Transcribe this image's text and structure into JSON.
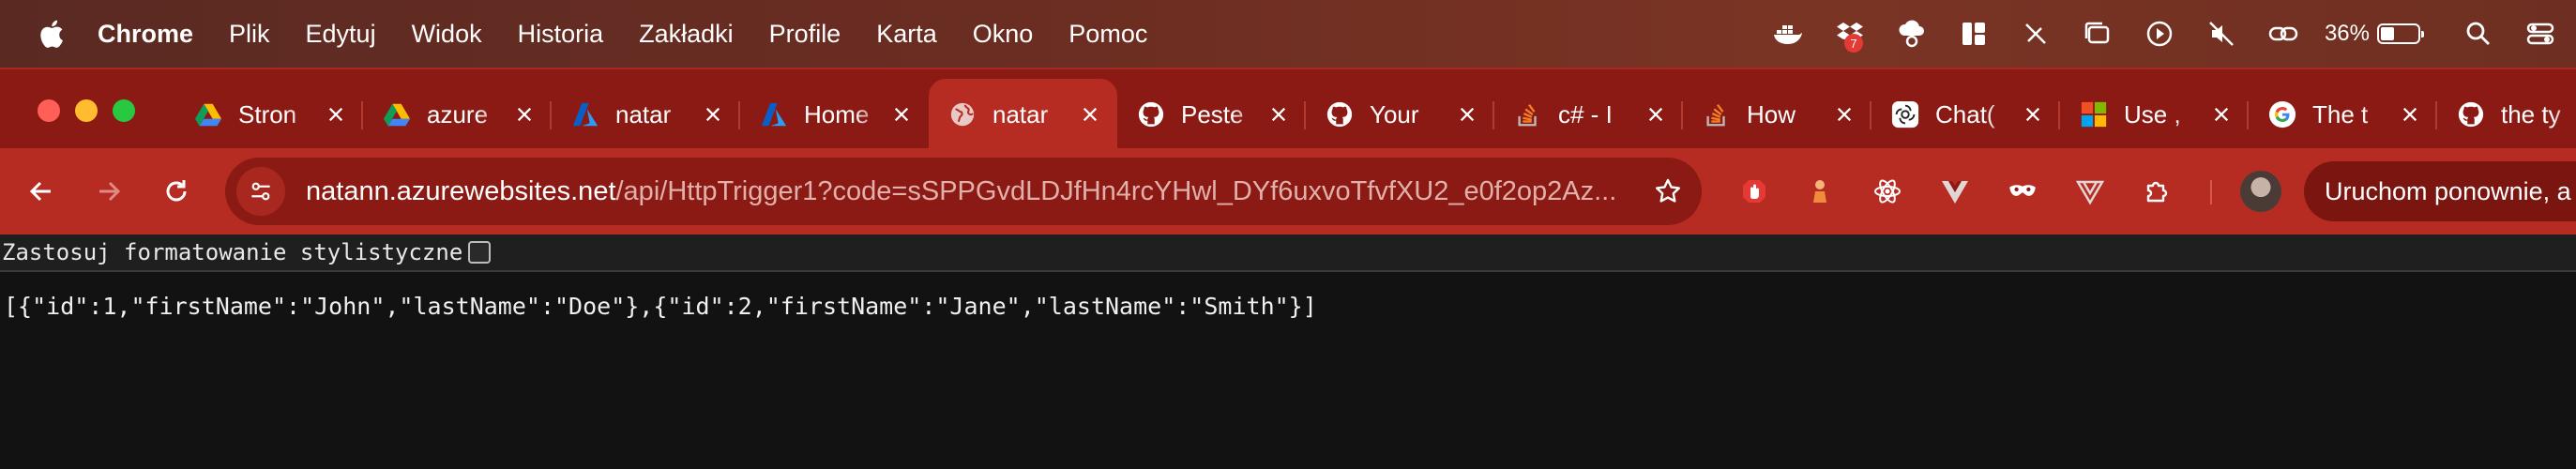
{
  "menubar": {
    "app": "Chrome",
    "items": [
      "Plik",
      "Edytuj",
      "Widok",
      "Historia",
      "Zakładki",
      "Profile",
      "Karta",
      "Okno",
      "Pomoc"
    ],
    "status": {
      "notification_badge": "7",
      "battery_percent": "36%",
      "battery_level": 0.36
    },
    "icons": [
      "docker-icon",
      "dropbox-icon",
      "cloud-fan-icon",
      "grid-app-icon",
      "pen-off-icon",
      "window-icon",
      "play-icon",
      "mute-icon",
      "link-icon",
      "battery-icon",
      "search-icon",
      "control-center-icon"
    ]
  },
  "tabs": [
    {
      "title": "Stron",
      "icon": "google-drive-icon"
    },
    {
      "title": "azure",
      "icon": "google-drive-icon"
    },
    {
      "title": "natar",
      "icon": "azure-icon"
    },
    {
      "title": "Home",
      "icon": "azure-icon"
    },
    {
      "title": "natar",
      "icon": "globe-icon",
      "active": true
    },
    {
      "title": "Peste",
      "icon": "github-icon"
    },
    {
      "title": "Your",
      "icon": "github-icon"
    },
    {
      "title": "c# - I",
      "icon": "stackoverflow-icon"
    },
    {
      "title": "How",
      "icon": "stackoverflow-icon"
    },
    {
      "title": "Chat(",
      "icon": "openai-icon"
    },
    {
      "title": "Use ,",
      "icon": "microsoft-icon"
    },
    {
      "title": "The t",
      "icon": "google-icon"
    },
    {
      "title": "the ty",
      "icon": "github-icon"
    }
  ],
  "toolbar": {
    "url_host": "natann.azurewebsites.net",
    "url_path": "/api/HttpTrigger1?code=sSPPGvdLDJfHn4rcYHwl_DYf6uxvoTfvfXU2_e0f2op2Az...",
    "relaunch_label": "Uruchom ponownie, a"
  },
  "page": {
    "pretty_print_label": "Zastosuj formatowanie stylistyczne",
    "pretty_print_checked": false,
    "json_text": "[{\"id\":1,\"firstName\":\"John\",\"lastName\":\"Doe\"},{\"id\":2,\"firstName\":\"Jane\",\"lastName\":\"Smith\"}]"
  },
  "colors": {
    "menubar": "#6b2d22",
    "tabstrip": "#8b1a14",
    "toolbar": "#b62c22",
    "page_bg": "#121212"
  }
}
